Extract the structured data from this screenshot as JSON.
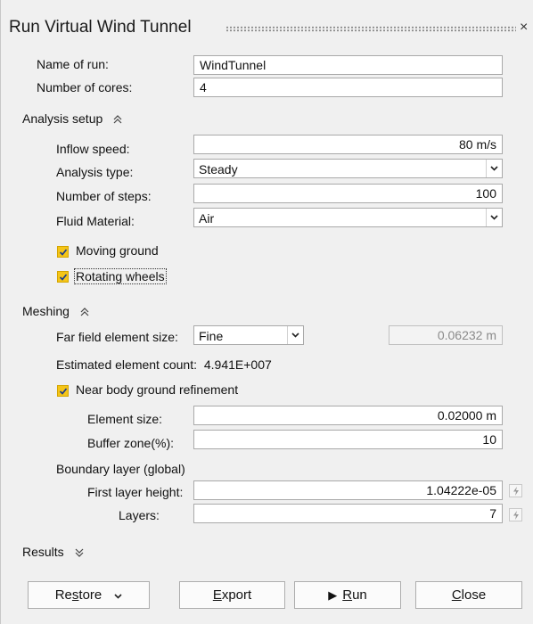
{
  "dialog": {
    "title": "Run Virtual Wind Tunnel",
    "close_glyph": "×"
  },
  "run": {
    "name_label": "Name of run:",
    "name_value": "WindTunnel",
    "cores_label": "Number of cores:",
    "cores_value": "4"
  },
  "analysis": {
    "header": "Analysis setup",
    "inflow_label": "Inflow speed:",
    "inflow_value": "80 m/s",
    "type_label": "Analysis type:",
    "type_value": "Steady",
    "steps_label": "Number of steps:",
    "steps_value": "100",
    "fluid_label": "Fluid Material:",
    "fluid_value": "Air",
    "moving_ground_label": "Moving ground",
    "rotating_wheels_label": "Rotating wheels"
  },
  "meshing": {
    "header": "Meshing",
    "far_field_label": "Far field element size:",
    "far_field_value": "Fine",
    "far_field_size": "0.06232 m",
    "estimated_label": "Estimated element count:",
    "estimated_value": "4.941E+007",
    "near_body_label": "Near body ground refinement",
    "element_size_label": "Element size:",
    "element_size_value": "0.02000 m",
    "buffer_label": "Buffer zone(%):",
    "buffer_value": "10",
    "boundary_header": "Boundary layer (global)",
    "first_layer_label": "First layer height:",
    "first_layer_value": "1.04222e-05",
    "layers_label": "Layers:",
    "layers_value": "7"
  },
  "results": {
    "header": "Results"
  },
  "buttons": {
    "restore_pre": "Re",
    "restore_ul": "s",
    "restore_post": "tore",
    "export_ul": "E",
    "export_post": "xport",
    "run_glyph": "▶",
    "run_ul": "R",
    "run_post": "un",
    "close_ul": "C",
    "close_post": "lose"
  },
  "colors": {
    "checkbox": "#f5c518",
    "background": "#f0f0f0"
  },
  "icons": {
    "section_collapse": "double-chevron-up-icon",
    "section_expand": "double-chevron-down-icon",
    "dropdown": "chevron-down-icon",
    "lightning": "lightning-icon"
  }
}
